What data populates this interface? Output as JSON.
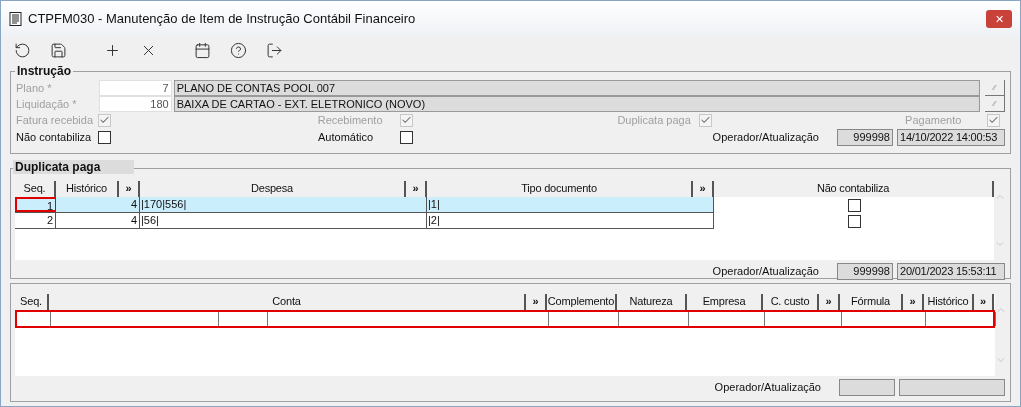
{
  "window": {
    "title": "CTPFM030 - Manutenção de Item de Instrução Contábil Financeiro",
    "close": "✕"
  },
  "instrucao": {
    "legend": "Instrução",
    "fields": [
      {
        "label": "Plano *",
        "code": "7",
        "description": "PLANO DE CONTAS POOL 007",
        "lookup": "⁄⁄"
      },
      {
        "label": "Liquidação *",
        "code": "180",
        "description": "BAIXA DE CARTAO - EXT. ELETRONICO (NOVO)",
        "lookup": "⁄⁄"
      }
    ],
    "flags_row_1": [
      {
        "label": "Fatura recebida",
        "checked": true,
        "disabled": true
      },
      {
        "label": "Recebimento",
        "checked": true,
        "disabled": true
      },
      {
        "label": "Duplicata paga",
        "checked": true,
        "disabled": true
      },
      {
        "label": "Pagamento",
        "checked": true,
        "disabled": true
      }
    ],
    "flags_row_2": [
      {
        "label": "Não contabiliza",
        "checked": false,
        "disabled": false
      },
      {
        "label": "Automático",
        "checked": false,
        "disabled": false
      }
    ],
    "operator": {
      "label": "Operador/Atualização",
      "code": "999998",
      "date": "14/10/2022 14:00:53"
    }
  },
  "duplicata": {
    "legend": "Duplicata paga",
    "columns": [
      {
        "label": "Seq.",
        "kind": "text"
      },
      {
        "label": "Histórico",
        "kind": "text"
      },
      {
        "label": "»",
        "kind": "expand"
      },
      {
        "label": "Despesa",
        "kind": "text"
      },
      {
        "label": "»",
        "kind": "expand"
      },
      {
        "label": "Tipo documento",
        "kind": "text"
      },
      {
        "label": "»",
        "kind": "expand"
      },
      {
        "label": "Não contabiliza",
        "kind": "text"
      }
    ],
    "rows": [
      {
        "seq": "1",
        "historico": "4",
        "despesa": "|170|556|",
        "tipo": "|1|",
        "nao_contabiliza": false,
        "selected": true,
        "highlighted": true
      },
      {
        "seq": "2",
        "historico": "4",
        "despesa": "|56|",
        "tipo": "|2|",
        "nao_contabiliza": false,
        "selected": false,
        "highlighted": false
      }
    ],
    "operator": {
      "label": "Operador/Atualização",
      "code": "999998",
      "date": "20/01/2023 15:53:11"
    }
  },
  "contas": {
    "columns": [
      {
        "label": "Seq.",
        "kind": "text"
      },
      {
        "label": "Conta",
        "kind": "text"
      },
      {
        "label": "»",
        "kind": "expand"
      },
      {
        "label": "Complemento",
        "kind": "text"
      },
      {
        "label": "Natureza",
        "kind": "text"
      },
      {
        "label": "Empresa",
        "kind": "text"
      },
      {
        "label": "C. custo",
        "kind": "text"
      },
      {
        "label": "»",
        "kind": "expand"
      },
      {
        "label": "Fórmula",
        "kind": "text"
      },
      {
        "label": "»",
        "kind": "expand"
      },
      {
        "label": "Histórico",
        "kind": "text"
      },
      {
        "label": "»",
        "kind": "expand"
      }
    ],
    "empty_row_highlighted": true,
    "operator": {
      "label": "Operador/Atualização"
    }
  }
}
